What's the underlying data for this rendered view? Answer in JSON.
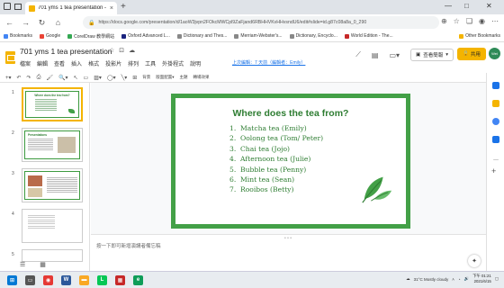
{
  "browser": {
    "tab_title": "701 yms 1 tea presentation - Go",
    "tab_close": "×",
    "new_tab": "+",
    "url": "https://docs.google.com/presentation/d/1aoW3jvpn2FOkcMWCpl9ZaFjand6RBHHVKvHHvsndU6/edit#slide=id.g87c08a8a_0_290",
    "minimize": "—",
    "maximize": "□",
    "close": "✕"
  },
  "bookmarks": {
    "items": [
      {
        "label": "Bookmarks",
        "color": "#4285f4"
      },
      {
        "label": "Google",
        "color": "#ea4335"
      },
      {
        "label": "CorelDraw 教學網站",
        "color": "#34a853"
      },
      {
        "label": "Oxford Advanced L...",
        "color": "#1a237e"
      },
      {
        "label": "Dictionary and Thes...",
        "color": "#666666"
      },
      {
        "label": "Merriam-Webster's...",
        "color": "#666666"
      },
      {
        "label": "Dictionary, Encyclo...",
        "color": "#666666"
      },
      {
        "label": "World Edition - The...",
        "color": "#c62828"
      }
    ],
    "other": "Other Bookmarks"
  },
  "slides": {
    "doc_title": "701 yms 1 tea presentation",
    "menu": [
      "檔案",
      "編輯",
      "查看",
      "插入",
      "格式",
      "投影片",
      "排列",
      "工具",
      "外掛程式",
      "說明"
    ],
    "last_edit": "上次編輯：7 天前（編輯者：Emily）",
    "present_label": "查看簡報",
    "share_label": "共用",
    "avatar_initials": "Wei"
  },
  "toolbar": {
    "background": "背景",
    "layout": "版面配置▾",
    "theme": "主題",
    "transition": "轉場效果"
  },
  "filmstrip": {
    "slides": [
      {
        "num": "1",
        "title": "Where does the tea from?",
        "selected": true
      },
      {
        "num": "2",
        "title": "Presentations"
      },
      {
        "num": "3",
        "title": ""
      },
      {
        "num": "4",
        "title": ""
      },
      {
        "num": "5",
        "title": ""
      }
    ]
  },
  "slide": {
    "title": "Where does the tea from?",
    "items": [
      {
        "num": "1.",
        "text": "Matcha tea (Emily)"
      },
      {
        "num": "2.",
        "text": "Oolong tea (Tom/ Peter)"
      },
      {
        "num": "3.",
        "text": "Chai tea (Jojo)"
      },
      {
        "num": "4.",
        "text": "Afternoon tea (Julie)"
      },
      {
        "num": "5.",
        "text": "Bubble tea (Penny)"
      },
      {
        "num": "6.",
        "text": "Mint tea (Sean)"
      },
      {
        "num": "7.",
        "text": "Rooibos (Betty)"
      }
    ],
    "accent": "#43a047",
    "text_color": "#2e7d32"
  },
  "notes": {
    "placeholder": "按一下即可新增演講者備忘稿"
  },
  "taskbar": {
    "weather": "31°C Mostly cloudy",
    "time": "下午 01:21",
    "date": "2021/6/15"
  },
  "colors": {
    "brand": "#f4b400",
    "green": "#43a047"
  }
}
